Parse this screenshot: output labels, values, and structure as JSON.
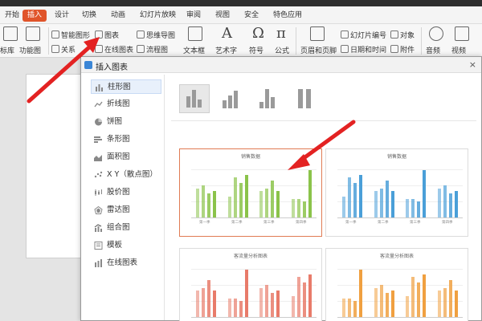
{
  "tabs": [
    {
      "label": "开始"
    },
    {
      "label": "插入",
      "active": true
    },
    {
      "label": "设计"
    },
    {
      "label": "切换"
    },
    {
      "label": "动画"
    },
    {
      "label": "幻灯片放映"
    },
    {
      "label": "审阅"
    },
    {
      "label": "视图"
    },
    {
      "label": "安全"
    },
    {
      "label": "特色应用"
    }
  ],
  "ribbon": {
    "library": "标库",
    "function_chart": "功能图",
    "smart_graphic": "智能图形",
    "chart": "图表",
    "relation": "关系",
    "online_chart": "在线图表",
    "mind_map": "思维导图",
    "flowchart": "流程图",
    "textbox": "文本框",
    "art_text": "艺术字",
    "symbol": "符号",
    "formula": "公式",
    "header_footer": "页眉和页脚",
    "slide_number": "幻灯片编号",
    "object": "对象",
    "datetime": "日期和时间",
    "attachment": "附件",
    "audio": "音频",
    "video": "视频"
  },
  "dialog": {
    "title": "插入图表",
    "close": "×",
    "categories": [
      {
        "label": "柱形图",
        "selected": true
      },
      {
        "label": "折线图"
      },
      {
        "label": "饼图"
      },
      {
        "label": "条形图"
      },
      {
        "label": "面积图"
      },
      {
        "label": "X Y（散点图）"
      },
      {
        "label": "股价图"
      },
      {
        "label": "雷达图"
      },
      {
        "label": "组合图"
      },
      {
        "label": "模板"
      },
      {
        "label": "在线图表"
      }
    ],
    "previews": [
      {
        "title": "销售数据",
        "color": "#8bc34a",
        "selected": true,
        "cats": [
          "第一季",
          "第二季",
          "第三季",
          "第四季"
        ]
      },
      {
        "title": "销售数据",
        "color": "#4a9fd8",
        "selected": false,
        "cats": [
          "第一季",
          "第二季",
          "第三季",
          "第四季"
        ]
      },
      {
        "title": "客流量分析图表",
        "color": "#e87b6a",
        "selected": false,
        "cats": []
      },
      {
        "title": "客流量分析图表",
        "color": "#f0a040",
        "selected": false,
        "cats": []
      }
    ]
  },
  "colors": {
    "accent": "#e0542a",
    "arrow": "#e32222"
  }
}
